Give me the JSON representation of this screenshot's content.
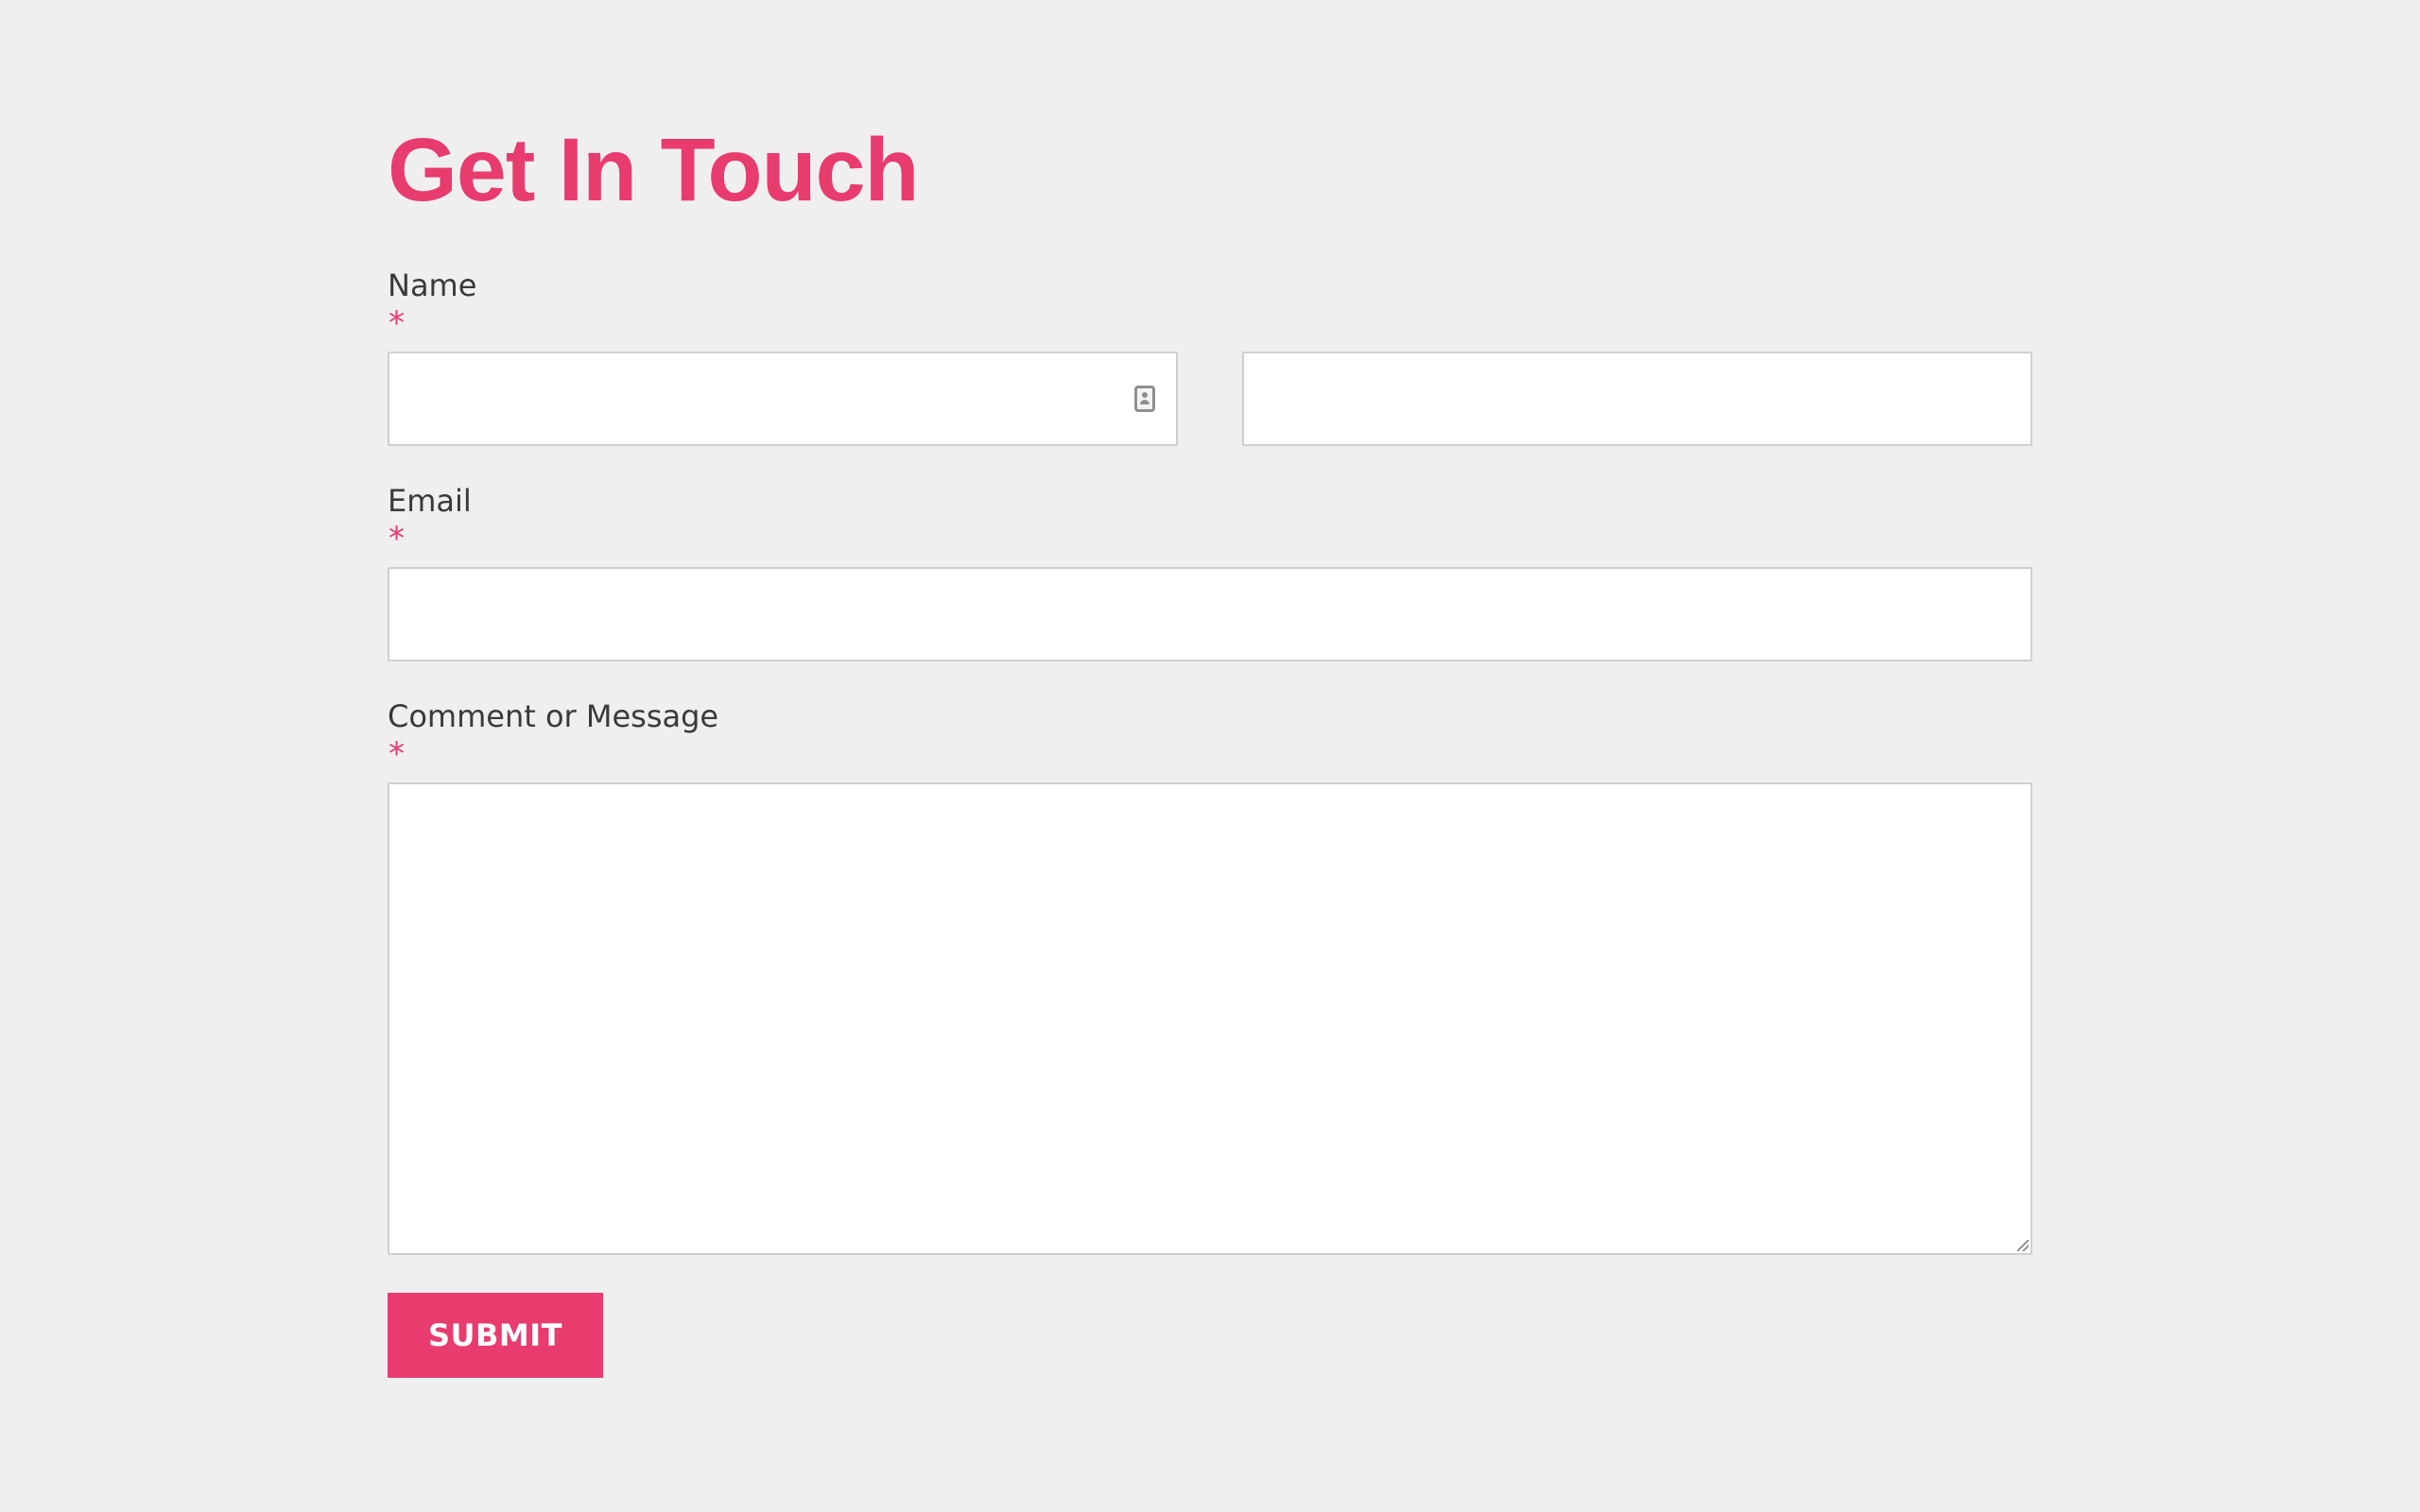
{
  "form": {
    "title": "Get In Touch",
    "required_marker": "*",
    "fields": {
      "name": {
        "label": "Name",
        "first_value": "",
        "last_value": "",
        "first_placeholder": "",
        "last_placeholder": ""
      },
      "email": {
        "label": "Email",
        "value": "",
        "placeholder": ""
      },
      "message": {
        "label": "Comment or Message",
        "value": "",
        "placeholder": ""
      }
    },
    "submit_label": "SUBMIT"
  },
  "colors": {
    "accent": "#e83b6e",
    "background": "#efefef",
    "label": "#3a3a3a",
    "input_border": "#cfcfcf"
  },
  "icons": {
    "autofill": "contact-card-icon"
  }
}
